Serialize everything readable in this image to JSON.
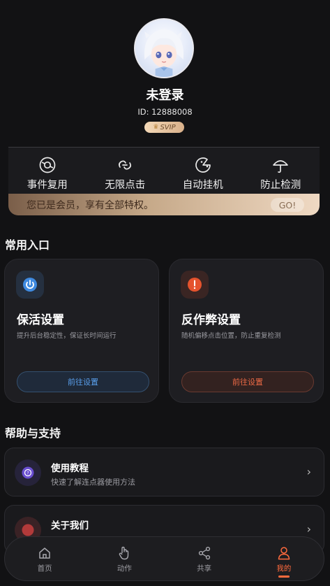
{
  "profile": {
    "username": "未登录",
    "user_id": "ID: 12888008",
    "badge": "SVIP"
  },
  "privileges": {
    "features": [
      {
        "label": "事件复用",
        "icon": "event-reuse-icon"
      },
      {
        "label": "无限点击",
        "icon": "infinite-click-icon"
      },
      {
        "label": "自动挂机",
        "icon": "auto-idle-icon"
      },
      {
        "label": "防止检测",
        "icon": "umbrella-icon"
      }
    ],
    "member_text": "您已是会员，享有全部特权。",
    "go_label": "GO!"
  },
  "common_entry": {
    "title": "常用入口",
    "cards": [
      {
        "title": "保活设置",
        "desc": "提升后台稳定性，保证长时间运行",
        "button": "前往设置",
        "icon": "power-icon",
        "accent": "#4a90e2"
      },
      {
        "title": "反作弊设置",
        "desc": "随机偏移点击位置，防止重复检测",
        "button": "前往设置",
        "icon": "alert-icon",
        "accent": "#e5532d"
      }
    ]
  },
  "help": {
    "title": "帮助与支持",
    "items": [
      {
        "title": "使用教程",
        "desc": "快速了解连点器使用方法",
        "icon": "tutorial-icon"
      },
      {
        "title": "关于我们",
        "desc": "",
        "icon": "about-icon"
      }
    ]
  },
  "tabbar": {
    "tabs": [
      {
        "label": "首页",
        "icon": "home-icon"
      },
      {
        "label": "动作",
        "icon": "hand-icon"
      },
      {
        "label": "共享",
        "icon": "share-icon"
      },
      {
        "label": "我的",
        "icon": "user-icon",
        "active": true
      }
    ],
    "active_color": "#ff6a3d"
  }
}
